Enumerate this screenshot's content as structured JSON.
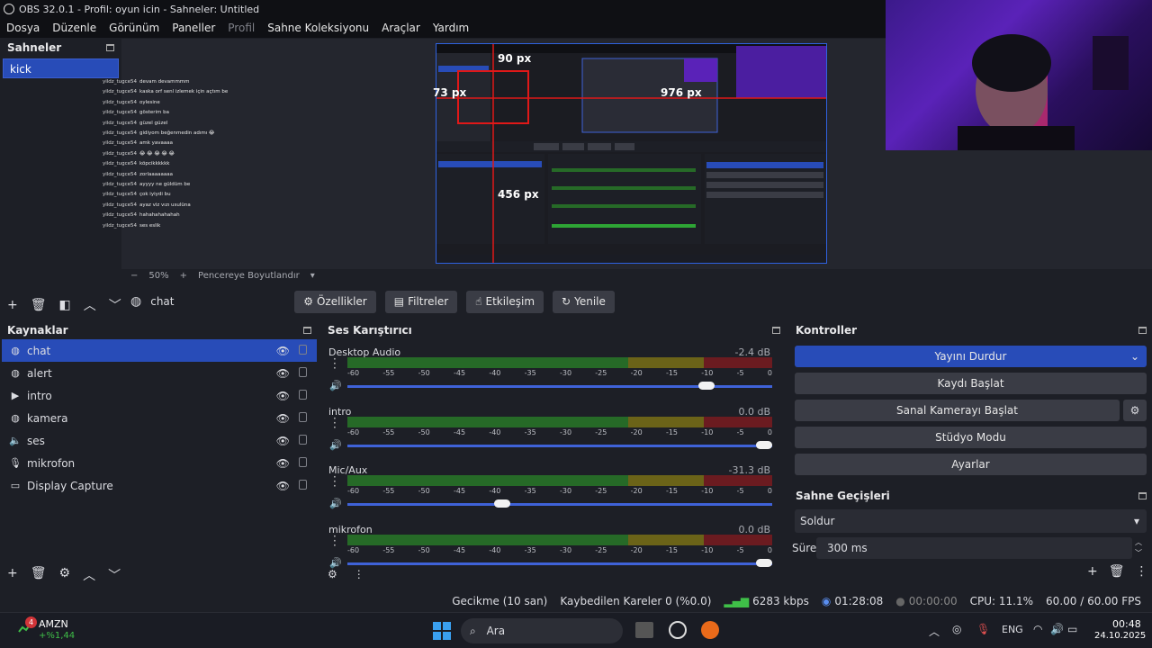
{
  "window": {
    "title": "OBS 32.0.1 - Profil: oyun icin - Sahneler: Untitled"
  },
  "menu": [
    "Dosya",
    "Düzenle",
    "Görünüm",
    "Paneller",
    "Profil",
    "Sahne Koleksiyonu",
    "Araçlar",
    "Yardım"
  ],
  "scenes": {
    "title": "Sahneler",
    "items": [
      "kick"
    ]
  },
  "chat": [
    {
      "user": "yildz_tugce54",
      "msg": "devam devammmm"
    },
    {
      "user": "yildz_tugce54",
      "msg": "kaska orf senl izlemek için açtım be"
    },
    {
      "user": "yildz_tugce54",
      "msg": "oylesine"
    },
    {
      "user": "yildz_tugce54",
      "msg": "gösterim ba"
    },
    {
      "user": "yildz_tugce54",
      "msg": "güzel güzel"
    },
    {
      "user": "yildz_tugce54",
      "msg": "gidiyom beğenmedin adımı 😂"
    },
    {
      "user": "yildz_tugce54",
      "msg": "amk yavaaaa"
    },
    {
      "user": "yildz_tugce54",
      "msg": "😂 😂 😂 😂 😂"
    },
    {
      "user": "yildz_tugce54",
      "msg": "köpcikkkkkk"
    },
    {
      "user": "yildz_tugce54",
      "msg": "zorlaaaaaaaa"
    },
    {
      "user": "yildz_tugce54",
      "msg": "ayyyy ne güldüm be"
    },
    {
      "user": "yildz_tugce54",
      "msg": "çok iyiydi bu"
    },
    {
      "user": "yildz_tugce54",
      "msg": "ayaz viz vızı usulüna"
    },
    {
      "user": "yildz_tugce54",
      "msg": "hahahahahahah"
    },
    {
      "user": "yildz_tugce54",
      "msg": "ses eslik"
    }
  ],
  "preview": {
    "measures": {
      "top": "90 px",
      "left": "73 px",
      "right": "976 px",
      "bottom": "456 px"
    },
    "zoom": "50%",
    "fit_label": "Pencereye Boyutlandır"
  },
  "selected_source": "chat",
  "toolbar": {
    "props": "Özellikler",
    "filters": "Filtreler",
    "interact": "Etkileşim",
    "refresh": "Yenile"
  },
  "sources": {
    "title": "Kaynaklar",
    "items": [
      "chat",
      "alert",
      "intro",
      "kamera",
      "ses",
      "mikrofon",
      "Display Capture"
    ]
  },
  "mixer": {
    "title": "Ses Karıştırıcı",
    "ticks": [
      "-60",
      "-55",
      "-50",
      "-45",
      "-40",
      "-35",
      "-30",
      "-25",
      "-20",
      "-15",
      "-10",
      "-5",
      "0"
    ],
    "channels": [
      {
        "name": "Desktop Audio",
        "db": "-2.4 dB",
        "level": 0.86
      },
      {
        "name": "intro",
        "db": "0.0 dB",
        "level": 1.0
      },
      {
        "name": "Mic/Aux",
        "db": "-31.3 dB",
        "level": 0.36
      },
      {
        "name": "mikrofon",
        "db": "0.0 dB",
        "level": 1.0
      }
    ]
  },
  "controls": {
    "title": "Kontroller",
    "stop_stream": "Yayını Durdur",
    "start_record": "Kaydı Başlat",
    "start_vcam": "Sanal Kamerayı Başlat",
    "studio": "Stüdyo Modu",
    "settings": "Ayarlar"
  },
  "transitions": {
    "title": "Sahne Geçişleri",
    "type": "Soldur",
    "duration_label": "Süre",
    "duration": "300 ms"
  },
  "status": {
    "delay": "Gecikme (10 san)",
    "dropped": "Kaybedilen Kareler 0 (%0.0)",
    "kbps": "6283 kbps",
    "stream_time": "01:28:08",
    "rec_time": "00:00:00",
    "cpu": "CPU: 11.1%",
    "fps": "60.00 / 60.00 FPS"
  },
  "taskbar": {
    "stock": "AMZN",
    "stock_change": "+%1,44",
    "badge": "4",
    "search": "Ara",
    "lang": "ENG",
    "time": "00:48",
    "date": "24.10.2025"
  },
  "colors": {
    "accent": "#284cb8",
    "bg": "#1d1f26",
    "red_guide": "#e01818"
  }
}
